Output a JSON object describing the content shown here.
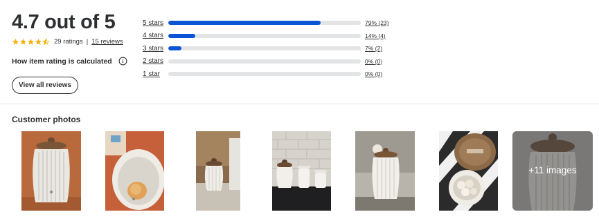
{
  "summary": {
    "average": "4.7 out of 5",
    "stars_value": 4.7,
    "ratings_count": "29 ratings",
    "separator": "|",
    "reviews_link": "15 reviews",
    "how_calculated": "How item rating is calculated",
    "view_all": "View all reviews"
  },
  "distribution": [
    {
      "label": "5 stars",
      "value": "79% (23)",
      "fraction": 0.79
    },
    {
      "label": "4 stars",
      "value": "14% (4)",
      "fraction": 0.14
    },
    {
      "label": "3 stars",
      "value": "7% (2)",
      "fraction": 0.07
    },
    {
      "label": "2 stars",
      "value": "0% (0)",
      "fraction": 0
    },
    {
      "label": "1 star",
      "value": "0% (0)",
      "fraction": 0
    }
  ],
  "photos": {
    "title": "Customer photos",
    "more_label": "+11 images"
  },
  "colors": {
    "accent": "#0b54d5",
    "star": "#f3b20f",
    "track": "#e3e4e5",
    "text": "#2e2f32"
  }
}
